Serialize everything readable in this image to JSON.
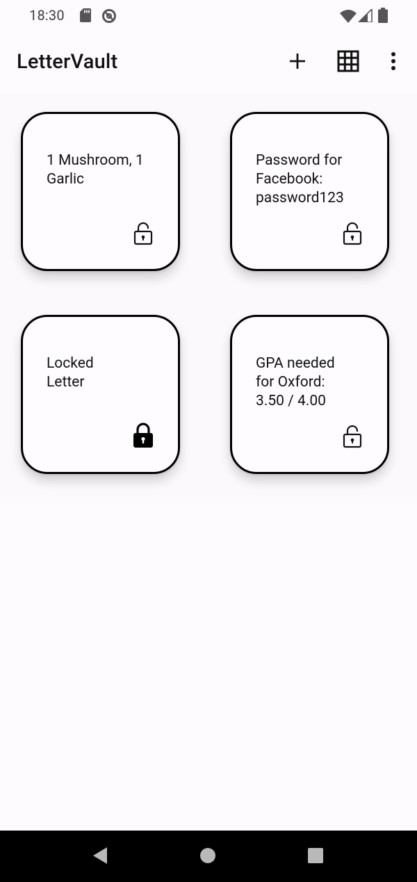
{
  "status_bar": {
    "time": "18:30",
    "icons": [
      "sd-card-icon",
      "no-disturb-icon",
      "wifi-icon",
      "signal-icon",
      "battery-icon"
    ]
  },
  "app_bar": {
    "title": "LetterVault",
    "actions": [
      "add-icon",
      "grid-view-icon",
      "more-vert-icon"
    ]
  },
  "letters": [
    {
      "text": "1 Mushroom, 1\nGarlic",
      "locked": false
    },
    {
      "text": "Password for\nFacebook:\npassword123",
      "locked": false
    },
    {
      "text": "Locked\nLetter",
      "locked": true
    },
    {
      "text": "GPA needed\nfor Oxford:\n3.50 / 4.00",
      "locked": false
    }
  ],
  "nav_bar": {
    "buttons": [
      "back-icon",
      "home-icon",
      "recents-icon"
    ]
  }
}
